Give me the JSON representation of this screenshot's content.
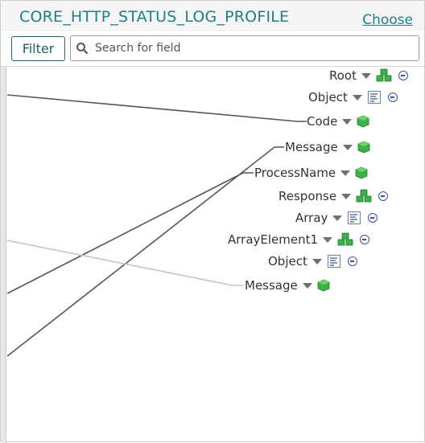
{
  "header": {
    "title": "CORE_HTTP_STATUS_LOG_PROFILE",
    "choose_label": "Choose"
  },
  "toolbar": {
    "filter_label": "Filter",
    "search_placeholder": "Search for field"
  },
  "tree": {
    "nodes": [
      {
        "label": "Root",
        "icon": "multi-cube-icon",
        "collapsible": true
      },
      {
        "label": "Object",
        "icon": "document-icon",
        "collapsible": true
      },
      {
        "label": "Code",
        "icon": "cube-icon",
        "collapsible": false
      },
      {
        "label": "Message",
        "icon": "cube-icon",
        "collapsible": false
      },
      {
        "label": "ProcessName",
        "icon": "cube-icon",
        "collapsible": false
      },
      {
        "label": "Response",
        "icon": "multi-cube-icon",
        "collapsible": true
      },
      {
        "label": "Array",
        "icon": "document-icon",
        "collapsible": true
      },
      {
        "label": "ArrayElement1",
        "icon": "multi-cube-icon",
        "collapsible": true
      },
      {
        "label": "Object",
        "icon": "document-icon",
        "collapsible": true
      },
      {
        "label": "Message",
        "icon": "cube-icon",
        "collapsible": false
      }
    ]
  },
  "colors": {
    "accent": "#1f7f86",
    "mapping_line": "#555555",
    "mapping_line_faded": "#c4c4c4",
    "cube_green": "#3cb04a",
    "collapse_blue": "#3b4fa0"
  }
}
